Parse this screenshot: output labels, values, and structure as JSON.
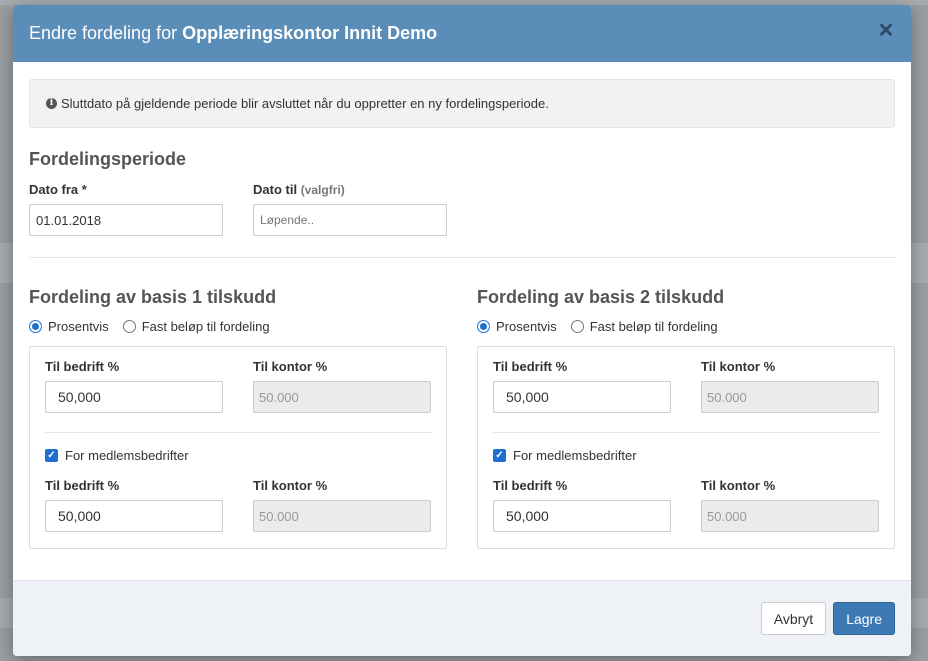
{
  "modal": {
    "title_prefix": "Endre fordeling for",
    "title_org": "Opplæringskontor Innit Demo",
    "close_symbol": "✕"
  },
  "info": {
    "icon": "info-circle-icon",
    "text": "Sluttdato på gjeldende periode blir avsluttet når du oppretter en ny fordelingsperiode."
  },
  "period": {
    "heading": "Fordelingsperiode",
    "date_from_label": "Dato fra *",
    "date_from_value": "01.01.2018",
    "date_to_label": "Dato til",
    "date_to_optional": "(valgfri)",
    "date_to_placeholder": "Løpende.."
  },
  "basis": [
    {
      "heading": "Fordeling av basis 1 tilskudd",
      "radio_percent": "Prosentvis",
      "radio_fixed": "Fast beløp til fordeling",
      "selected": "Prosentvis",
      "company_label": "Til bedrift %",
      "company_value": "50,000",
      "office_label": "Til kontor %",
      "office_value": "50.000",
      "members_label": "For medlemsbedrifter",
      "members_checked": true,
      "members_company_label": "Til bedrift %",
      "members_company_value": "50,000",
      "members_office_label": "Til kontor %",
      "members_office_value": "50.000"
    },
    {
      "heading": "Fordeling av basis 2 tilskudd",
      "radio_percent": "Prosentvis",
      "radio_fixed": "Fast beløp til fordeling",
      "selected": "Prosentvis",
      "company_label": "Til bedrift %",
      "company_value": "50,000",
      "office_label": "Til kontor %",
      "office_value": "50.000",
      "members_label": "For medlemsbedrifter",
      "members_checked": true,
      "members_company_label": "Til bedrift %",
      "members_company_value": "50,000",
      "members_office_label": "Til kontor %",
      "members_office_value": "50.000"
    }
  ],
  "footer": {
    "cancel_label": "Avbryt",
    "save_label": "Lagre"
  },
  "colors": {
    "header": "#5b8db9",
    "primary": "#3d7ab5",
    "accent": "#1f6fd1"
  }
}
